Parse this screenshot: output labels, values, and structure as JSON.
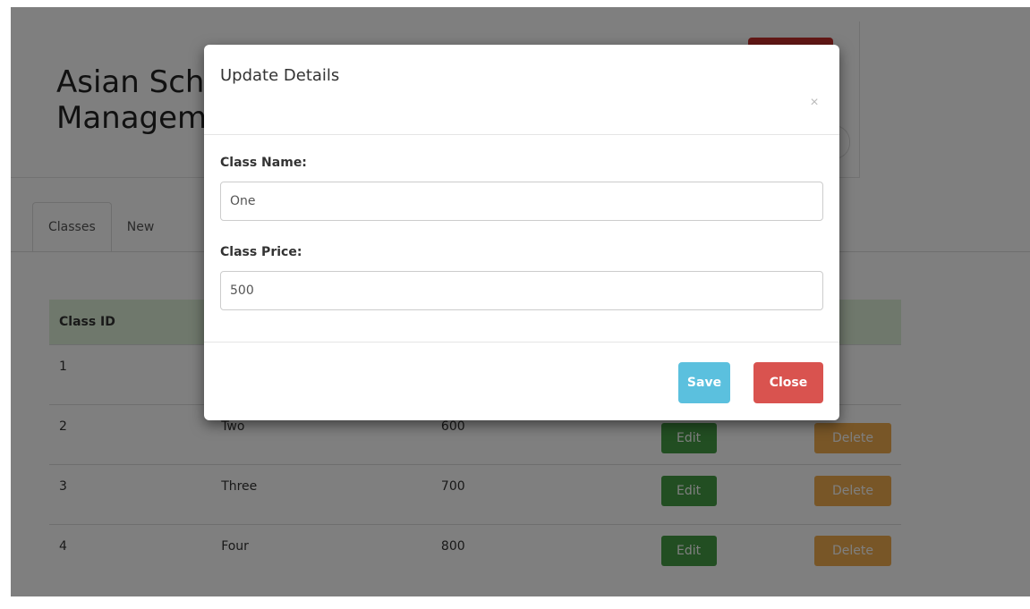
{
  "header": {
    "site_title": "Asian School\nManagement",
    "logout_label": ""
  },
  "tabs": [
    {
      "label": "Classes"
    },
    {
      "label": "New"
    }
  ],
  "table": {
    "columns": [
      "Class ID",
      "",
      "",
      "",
      ""
    ],
    "rows": [
      {
        "id": "1",
        "name": "",
        "price": ""
      },
      {
        "id": "2",
        "name": "Two",
        "price": "600"
      },
      {
        "id": "3",
        "name": "Three",
        "price": "700"
      },
      {
        "id": "4",
        "name": "Four",
        "price": "800"
      }
    ],
    "edit_label": "Edit",
    "delete_label": "Delete"
  },
  "modal": {
    "title": "Update Details",
    "close_icon": "×",
    "class_name_label": "Class Name:",
    "class_name_value": "One",
    "class_price_label": "Class Price:",
    "class_price_value": "500",
    "save_label": "Save",
    "close_label": "Close"
  },
  "colors": {
    "header_row_bg": "#dff0d8",
    "edit_button": "#449d44",
    "delete_button": "#f0ad4e",
    "save_button": "#5bc0de",
    "close_button": "#d9534f",
    "logout_button": "#c9302c"
  }
}
